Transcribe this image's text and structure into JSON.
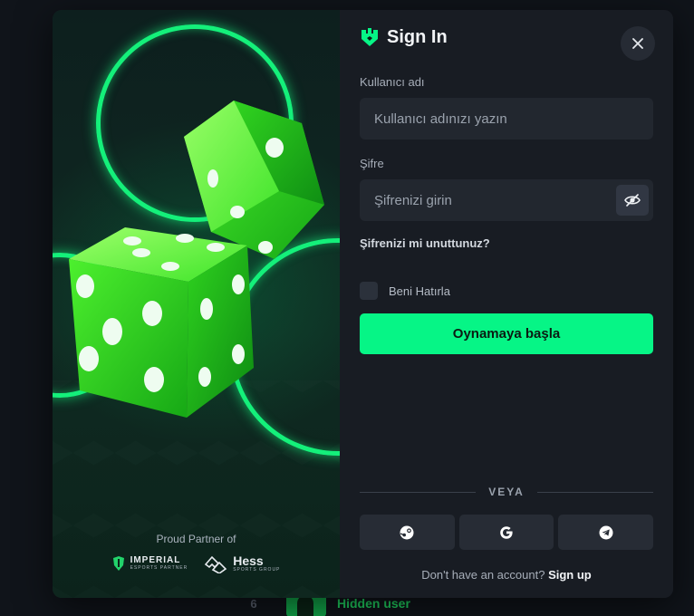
{
  "background": {
    "row_rank": "6",
    "row_user": "Hidden user"
  },
  "modal": {
    "title": "Sign In",
    "close_icon": "close-icon",
    "username": {
      "label": "Kullanıcı adı",
      "placeholder": "Kullanıcı adınızı yazın",
      "value": ""
    },
    "password": {
      "label": "Şifre",
      "placeholder": "Şifrenizi girin",
      "value": "",
      "toggle_icon": "eye-off-icon"
    },
    "forgot_link": "Şifrenizi mi unuttunuz?",
    "remember_me": {
      "label": "Beni Hatırla",
      "checked": false
    },
    "submit_label": "Oynamaya başla",
    "divider_text": "VEYA",
    "social": [
      {
        "icon": "steam-icon"
      },
      {
        "icon": "google-icon"
      },
      {
        "icon": "telegram-icon"
      }
    ],
    "signup_prompt": "Don't have an account?",
    "signup_link": "Sign up"
  },
  "art": {
    "partner_title": "Proud Partner of",
    "partners": [
      {
        "name": "IMPERIAL",
        "sub": "ESPORTS PARTNER",
        "icon": "imperial-logo"
      },
      {
        "name": "Hess",
        "sub": "SPORTS GROUP",
        "icon": "hess-logo"
      }
    ]
  },
  "colors": {
    "accent": "#06f586",
    "ring": "#14f07a",
    "panel": "#181c23",
    "input": "#22272f"
  }
}
